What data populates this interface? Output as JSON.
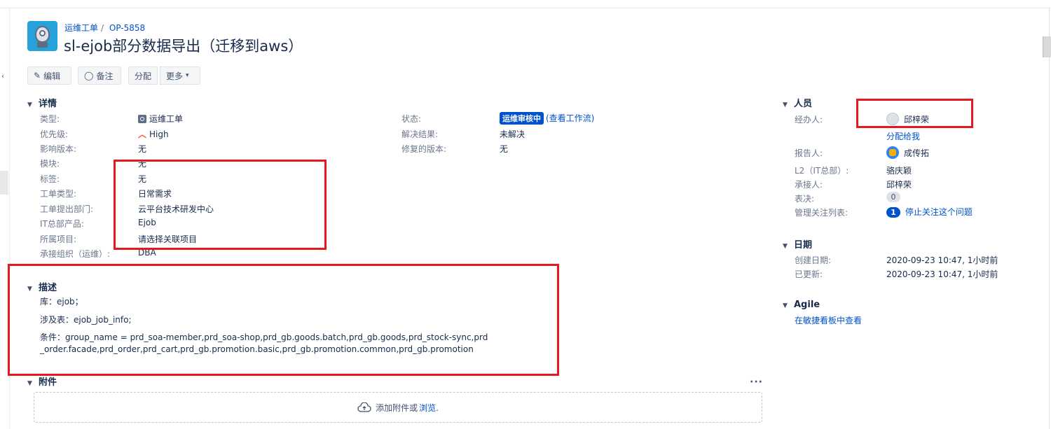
{
  "header": {
    "breadcrumb_project": "运维工单",
    "breadcrumb_issue": "OP-5858",
    "title": "sl-ejob部分数据导出（迁移到aws）"
  },
  "toolbar": {
    "edit": "编辑",
    "comment": "备注",
    "assign": "分配",
    "more": "更多"
  },
  "details": {
    "title": "详情",
    "type_label": "类型:",
    "type_value": "运维工单",
    "priority_label": "优先级:",
    "priority_value": "High",
    "affects_label": "影响版本:",
    "affects_value": "无",
    "module_label": "模块:",
    "module_value": "无",
    "tags_label": "标签:",
    "tags_value": "无",
    "ticket_type_label": "工单类型:",
    "ticket_type_value": "日常需求",
    "dept_label": "工单提出部门:",
    "dept_value": "云平台技术研发中心",
    "product_label": "IT总部产品:",
    "product_value": "Ejob",
    "project_label": "所属项目:",
    "project_value": "请选择关联项目",
    "org_label": "承接组织（运维）:",
    "org_value": "DBA",
    "status_label": "状态:",
    "status_value": "运维审核中",
    "status_link": "(查看工作流)",
    "resolution_label": "解决结果:",
    "resolution_value": "未解决",
    "fix_label": "修复的版本:",
    "fix_value": "无"
  },
  "description": {
    "title": "描述",
    "line1": "库：ejob；",
    "line2": "涉及表：ejob_job_info;",
    "line3": "条件：group_name = prd_soa-member,prd_soa-shop,prd_gb.goods.batch,prd_gb.goods,prd_stock-sync,prd_order.facade,prd_order,prd_cart,prd_gb.promotion.basic,prd_gb.promotion.common,prd_gb.promotion"
  },
  "attachments": {
    "title": "附件",
    "drop_text": "添加附件或",
    "browse": "浏览."
  },
  "people": {
    "title": "人员",
    "assignee_label": "经办人:",
    "assignee_value": "邱梓荣",
    "assign_to_me": "分配给我",
    "reporter_label": "报告人:",
    "reporter_value": "成传拓",
    "l2_label": "L2（IT总部）:",
    "l2_value": "骆庆颖",
    "undertaker_label": "承接人:",
    "undertaker_value": "邱梓荣",
    "votes_label": "表决:",
    "votes_value": "0",
    "watchers_label": "管理关注列表:",
    "watchers_count": "1",
    "watchers_link": "停止关注这个问题"
  },
  "dates": {
    "title": "日期",
    "created_label": "创建日期:",
    "created_value": "2020-09-23 10:47, 1小时前",
    "updated_label": "已更新:",
    "updated_value": "2020-09-23 10:47, 1小时前"
  },
  "agile": {
    "title": "Agile",
    "link": "在敏捷看板中查看"
  },
  "colors": {
    "link": "#0052cc",
    "status": "#0052cc",
    "priority": "#ff5630",
    "annotation": "#e4181f"
  }
}
